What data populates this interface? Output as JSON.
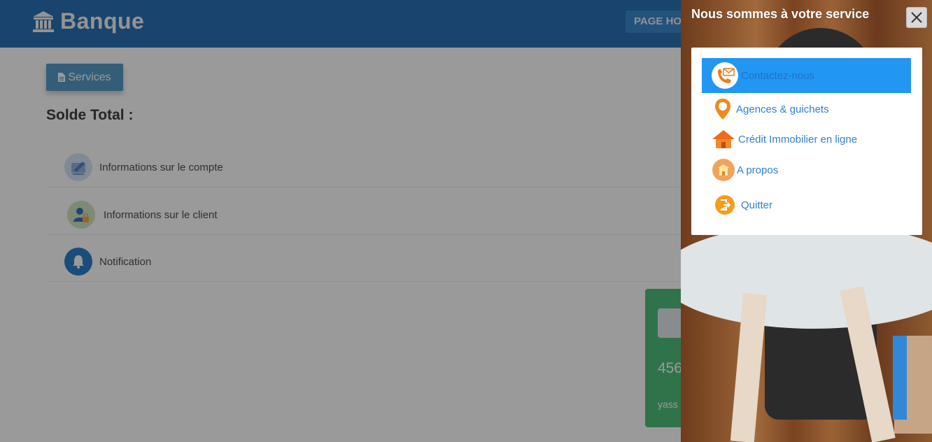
{
  "header": {
    "brand_name": "Banque",
    "nav_button_label": "PAGE HO"
  },
  "main": {
    "services_button_label": "Services",
    "solde_title": "Solde Total :",
    "rows": [
      {
        "label": "Informations sur le compte"
      },
      {
        "label": "Informations sur le client"
      },
      {
        "label": "Notification"
      }
    ]
  },
  "card": {
    "number_partial": "456",
    "holder_partial": "yass"
  },
  "side_panel": {
    "title": "Nous sommes à votre service",
    "menu": [
      {
        "label": "Contactez-nous",
        "icon": "phone-mail-icon",
        "active": true
      },
      {
        "label": "Agences & guichets",
        "icon": "location-pin-icon"
      },
      {
        "label": "Crédit Immobilier en ligne",
        "icon": "house-icon"
      },
      {
        "label": "A propos",
        "icon": "building-icon"
      },
      {
        "label": "Quitter",
        "icon": "exit-icon"
      }
    ]
  },
  "colors": {
    "header_bg": "#0a5eab",
    "menu_active": "#2196f3",
    "menu_text": "#2f7fd1",
    "card_bg": "#38b56a",
    "icon_orange": "#f79c1c"
  }
}
